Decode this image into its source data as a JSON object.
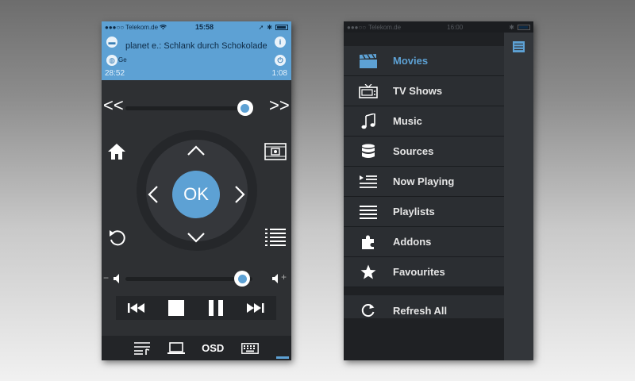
{
  "left": {
    "status": {
      "carrier": "Telekom.de",
      "time": "15:58"
    },
    "now_playing": {
      "title": "planet e.: Schlank durch Schokolade",
      "info_label": "Ge",
      "elapsed": "28:52",
      "duration": "1:08",
      "seek_progress": 0.93,
      "volume_level": 0.92
    },
    "nav": {
      "rewind": "<<",
      "forward": ">>",
      "ok_label": "OK"
    },
    "bottom": {
      "osd_label": "OSD"
    }
  },
  "right": {
    "status": {
      "carrier": "Telekom.de",
      "time": "16:00"
    },
    "menu": [
      {
        "label": "Movies",
        "icon": "clapperboard-icon",
        "active": true
      },
      {
        "label": "TV Shows",
        "icon": "tv-icon",
        "active": false
      },
      {
        "label": "Music",
        "icon": "music-note-icon",
        "active": false
      },
      {
        "label": "Sources",
        "icon": "database-icon",
        "active": false
      },
      {
        "label": "Now Playing",
        "icon": "now-playing-icon",
        "active": false
      },
      {
        "label": "Playlists",
        "icon": "list-icon",
        "active": false
      },
      {
        "label": "Addons",
        "icon": "puzzle-icon",
        "active": false
      },
      {
        "label": "Favourites",
        "icon": "star-icon",
        "active": false
      }
    ],
    "refresh_label": "Refresh All"
  },
  "colors": {
    "accent": "#5da1d4",
    "panel": "#2e3033",
    "menu_bg": "#2b2e32"
  }
}
